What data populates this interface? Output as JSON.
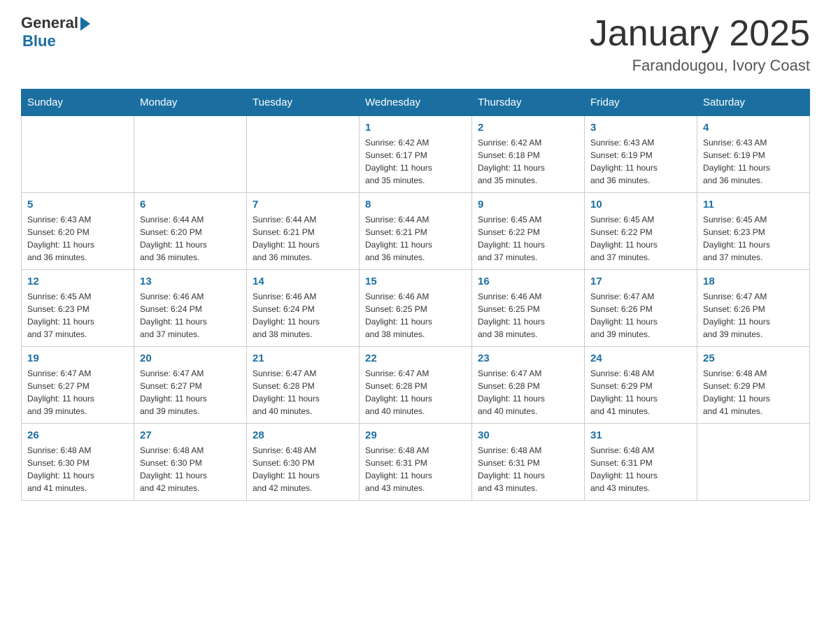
{
  "header": {
    "logo_general": "General",
    "logo_blue": "Blue",
    "month_title": "January 2025",
    "location": "Farandougou, Ivory Coast"
  },
  "days_of_week": [
    "Sunday",
    "Monday",
    "Tuesday",
    "Wednesday",
    "Thursday",
    "Friday",
    "Saturday"
  ],
  "weeks": [
    [
      {
        "day": "",
        "info": ""
      },
      {
        "day": "",
        "info": ""
      },
      {
        "day": "",
        "info": ""
      },
      {
        "day": "1",
        "info": "Sunrise: 6:42 AM\nSunset: 6:17 PM\nDaylight: 11 hours\nand 35 minutes."
      },
      {
        "day": "2",
        "info": "Sunrise: 6:42 AM\nSunset: 6:18 PM\nDaylight: 11 hours\nand 35 minutes."
      },
      {
        "day": "3",
        "info": "Sunrise: 6:43 AM\nSunset: 6:19 PM\nDaylight: 11 hours\nand 36 minutes."
      },
      {
        "day": "4",
        "info": "Sunrise: 6:43 AM\nSunset: 6:19 PM\nDaylight: 11 hours\nand 36 minutes."
      }
    ],
    [
      {
        "day": "5",
        "info": "Sunrise: 6:43 AM\nSunset: 6:20 PM\nDaylight: 11 hours\nand 36 minutes."
      },
      {
        "day": "6",
        "info": "Sunrise: 6:44 AM\nSunset: 6:20 PM\nDaylight: 11 hours\nand 36 minutes."
      },
      {
        "day": "7",
        "info": "Sunrise: 6:44 AM\nSunset: 6:21 PM\nDaylight: 11 hours\nand 36 minutes."
      },
      {
        "day": "8",
        "info": "Sunrise: 6:44 AM\nSunset: 6:21 PM\nDaylight: 11 hours\nand 36 minutes."
      },
      {
        "day": "9",
        "info": "Sunrise: 6:45 AM\nSunset: 6:22 PM\nDaylight: 11 hours\nand 37 minutes."
      },
      {
        "day": "10",
        "info": "Sunrise: 6:45 AM\nSunset: 6:22 PM\nDaylight: 11 hours\nand 37 minutes."
      },
      {
        "day": "11",
        "info": "Sunrise: 6:45 AM\nSunset: 6:23 PM\nDaylight: 11 hours\nand 37 minutes."
      }
    ],
    [
      {
        "day": "12",
        "info": "Sunrise: 6:45 AM\nSunset: 6:23 PM\nDaylight: 11 hours\nand 37 minutes."
      },
      {
        "day": "13",
        "info": "Sunrise: 6:46 AM\nSunset: 6:24 PM\nDaylight: 11 hours\nand 37 minutes."
      },
      {
        "day": "14",
        "info": "Sunrise: 6:46 AM\nSunset: 6:24 PM\nDaylight: 11 hours\nand 38 minutes."
      },
      {
        "day": "15",
        "info": "Sunrise: 6:46 AM\nSunset: 6:25 PM\nDaylight: 11 hours\nand 38 minutes."
      },
      {
        "day": "16",
        "info": "Sunrise: 6:46 AM\nSunset: 6:25 PM\nDaylight: 11 hours\nand 38 minutes."
      },
      {
        "day": "17",
        "info": "Sunrise: 6:47 AM\nSunset: 6:26 PM\nDaylight: 11 hours\nand 39 minutes."
      },
      {
        "day": "18",
        "info": "Sunrise: 6:47 AM\nSunset: 6:26 PM\nDaylight: 11 hours\nand 39 minutes."
      }
    ],
    [
      {
        "day": "19",
        "info": "Sunrise: 6:47 AM\nSunset: 6:27 PM\nDaylight: 11 hours\nand 39 minutes."
      },
      {
        "day": "20",
        "info": "Sunrise: 6:47 AM\nSunset: 6:27 PM\nDaylight: 11 hours\nand 39 minutes."
      },
      {
        "day": "21",
        "info": "Sunrise: 6:47 AM\nSunset: 6:28 PM\nDaylight: 11 hours\nand 40 minutes."
      },
      {
        "day": "22",
        "info": "Sunrise: 6:47 AM\nSunset: 6:28 PM\nDaylight: 11 hours\nand 40 minutes."
      },
      {
        "day": "23",
        "info": "Sunrise: 6:47 AM\nSunset: 6:28 PM\nDaylight: 11 hours\nand 40 minutes."
      },
      {
        "day": "24",
        "info": "Sunrise: 6:48 AM\nSunset: 6:29 PM\nDaylight: 11 hours\nand 41 minutes."
      },
      {
        "day": "25",
        "info": "Sunrise: 6:48 AM\nSunset: 6:29 PM\nDaylight: 11 hours\nand 41 minutes."
      }
    ],
    [
      {
        "day": "26",
        "info": "Sunrise: 6:48 AM\nSunset: 6:30 PM\nDaylight: 11 hours\nand 41 minutes."
      },
      {
        "day": "27",
        "info": "Sunrise: 6:48 AM\nSunset: 6:30 PM\nDaylight: 11 hours\nand 42 minutes."
      },
      {
        "day": "28",
        "info": "Sunrise: 6:48 AM\nSunset: 6:30 PM\nDaylight: 11 hours\nand 42 minutes."
      },
      {
        "day": "29",
        "info": "Sunrise: 6:48 AM\nSunset: 6:31 PM\nDaylight: 11 hours\nand 43 minutes."
      },
      {
        "day": "30",
        "info": "Sunrise: 6:48 AM\nSunset: 6:31 PM\nDaylight: 11 hours\nand 43 minutes."
      },
      {
        "day": "31",
        "info": "Sunrise: 6:48 AM\nSunset: 6:31 PM\nDaylight: 11 hours\nand 43 minutes."
      },
      {
        "day": "",
        "info": ""
      }
    ]
  ]
}
